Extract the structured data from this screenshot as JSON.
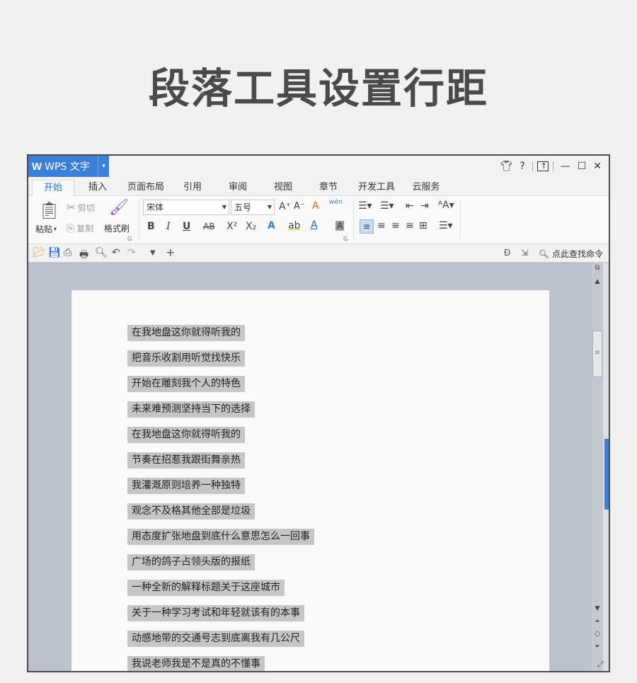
{
  "heading": "段落工具设置行距",
  "titlebar": {
    "logo": "W",
    "app_name": "WPS 文字",
    "app_dropdown": "▾",
    "right_icons": [
      "shirt-icon",
      "help-icon",
      "upload-icon",
      "minimize-icon",
      "maximize-icon",
      "close-icon"
    ],
    "help": "?",
    "minimize": "—",
    "maximize": "☐",
    "close": "✕"
  },
  "tabs": [
    {
      "label": "开始",
      "active": true
    },
    {
      "label": "插入"
    },
    {
      "label": "页面布局"
    },
    {
      "label": "引用"
    },
    {
      "label": "审阅"
    },
    {
      "label": "视图"
    },
    {
      "label": "章节"
    },
    {
      "label": "开发工具"
    },
    {
      "label": "云服务"
    }
  ],
  "ribbon": {
    "paste": "粘贴",
    "cut": "剪切",
    "copy": "复制",
    "format_painter": "格式刷",
    "font_name": "宋体",
    "font_size": "五号",
    "bold": "B",
    "italic": "I",
    "underline": "U",
    "strike": "AB",
    "superscript": "X²",
    "subscript": "X₂",
    "text_effect": "A",
    "highlight": "ab",
    "font_color": "A",
    "char_shade": "A",
    "grow_font": "A⁺",
    "shrink_font": "A⁻",
    "clear_format": "A",
    "phonetic": "wén",
    "group_mark": "G"
  },
  "qat": {
    "find_label": "点此查找命令"
  },
  "document": {
    "lines": [
      "在我地盘这你就得听我的",
      "把音乐收割用听觉找快乐",
      "开始在雕刻我个人的特色",
      "未来难预测坚持当下的选择",
      "在我地盘这你就得听我的",
      "节奏在招惹我跟街舞亲热",
      "我灌溉原则培养一种独特",
      "观念不及格其他全部是垃圾",
      "用态度扩张地盘到底什么意思怎么一回事",
      "广场的鸽子占领头版的报纸",
      "一种全新的解释标题关于这座城市",
      "关于一种学习考试和年轻就该有的本事",
      "动感地带的交通号志到底离我有几公尺",
      "我说老师我是不是真的不懂事"
    ]
  },
  "colors": {
    "accent": "#3c7fd6",
    "selection": "#c6c6c6",
    "doc_background": "#bcc1cb"
  }
}
